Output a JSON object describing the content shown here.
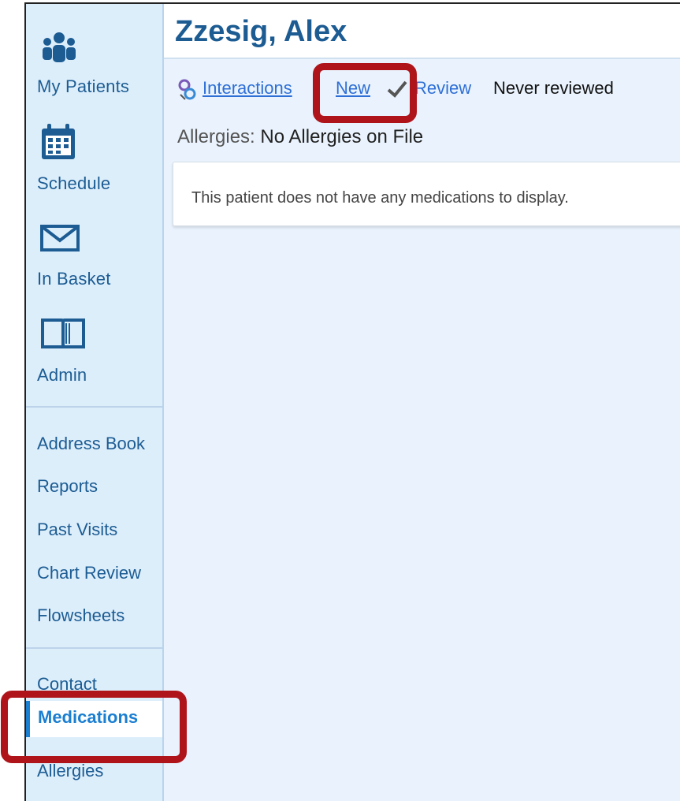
{
  "sidebar": {
    "primary": [
      {
        "label": "My Patients",
        "icon": "patients-icon"
      },
      {
        "label": "Schedule",
        "icon": "calendar-icon"
      },
      {
        "label": "In Basket",
        "icon": "envelope-icon"
      },
      {
        "label": "Admin",
        "icon": "book-icon"
      }
    ],
    "secondary": [
      "Address Book",
      "Reports",
      "Past Visits",
      "Chart Review",
      "Flowsheets"
    ],
    "chart": {
      "contact": "Contact",
      "active": "Medications",
      "allergies": "Allergies"
    }
  },
  "header": {
    "patient_name": "Zzesig, Alex"
  },
  "toolbar": {
    "interactions_label": "Interactions",
    "new_label": "New",
    "review_label": "Review",
    "review_status": "Never reviewed"
  },
  "allergies": {
    "label": "Allergies:",
    "value": "No Allergies on File"
  },
  "medications": {
    "empty_message": "This patient does not have any medications to display."
  },
  "colors": {
    "accent": "#1a7ed1",
    "nav_text": "#1c5c93",
    "highlight": "#b0141b",
    "link": "#2e6fd6"
  }
}
